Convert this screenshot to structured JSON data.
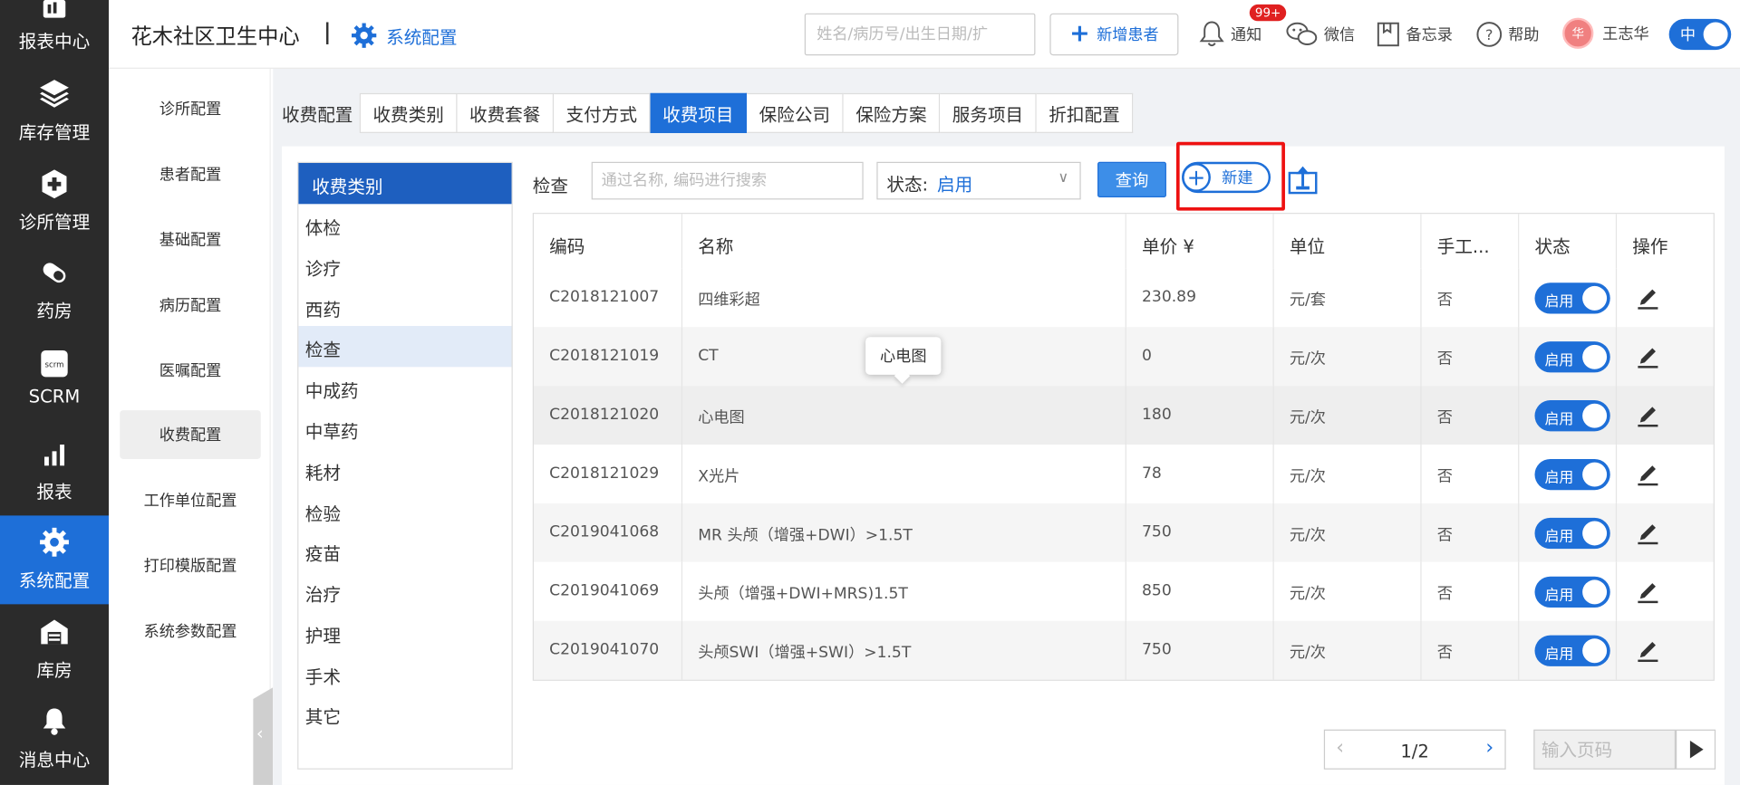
{
  "nav": {
    "items": [
      {
        "label": "报表中心",
        "icon": "report-center-icon"
      },
      {
        "label": "库存管理",
        "icon": "layers-icon"
      },
      {
        "label": "诊所管理",
        "icon": "medical-cross-icon"
      },
      {
        "label": "药房",
        "icon": "pill-icon"
      },
      {
        "label": "SCRM",
        "icon": "scrm-icon"
      },
      {
        "label": "报表",
        "icon": "bar-chart-icon"
      },
      {
        "label": "系统配置",
        "icon": "gear-icon"
      },
      {
        "label": "库房",
        "icon": "warehouse-icon"
      },
      {
        "label": "消息中心",
        "icon": "bell-icon"
      }
    ],
    "active_index": 6
  },
  "header": {
    "clinic_name": "花木社区卫生中心",
    "module": "系统配置",
    "search_placeholder": "姓名/病历号/出生日期/扩",
    "add_patient_label": "新增患者",
    "notify_label": "通知",
    "notify_badge": "99+",
    "wechat_label": "微信",
    "memo_label": "备忘录",
    "help_label": "帮助",
    "avatar_text": "华",
    "user_name": "王志华",
    "lang_label": "中"
  },
  "side_menu": {
    "items": [
      "诊所配置",
      "患者配置",
      "基础配置",
      "病历配置",
      "医嘱配置",
      "收费配置",
      "工作单位配置",
      "打印模版配置",
      "系统参数配置"
    ],
    "active_index": 5
  },
  "tabs": {
    "title": "收费配置",
    "items": [
      "收费类别",
      "收费套餐",
      "支付方式",
      "收费项目",
      "保险公司",
      "保险方案",
      "服务项目",
      "折扣配置"
    ],
    "active_index": 3
  },
  "categories": {
    "header": "收费类别",
    "items": [
      "体检",
      "诊疗",
      "西药",
      "检查",
      "中成药",
      "中草药",
      "耗材",
      "检验",
      "疫苗",
      "治疗",
      "护理",
      "手术",
      "其它"
    ],
    "selected_index": 3
  },
  "filter": {
    "label": "检查",
    "search_placeholder": "通过名称, 编码进行搜索",
    "status_label": "状态:",
    "status_value": "启用",
    "query_label": "查询",
    "new_label": "新建"
  },
  "table": {
    "columns": [
      "编码",
      "名称",
      "单价 ¥",
      "单位",
      "手工...",
      "状态",
      "操作"
    ],
    "rows": [
      {
        "code": "C2018121007",
        "name": "四维彩超",
        "price": "230.89",
        "unit": "元/套",
        "manual": "否",
        "status": "启用"
      },
      {
        "code": "C2018121019",
        "name": "CT",
        "price": "0",
        "unit": "元/次",
        "manual": "否",
        "status": "启用"
      },
      {
        "code": "C2018121020",
        "name": "心电图",
        "price": "180",
        "unit": "元/次",
        "manual": "否",
        "status": "启用"
      },
      {
        "code": "C2018121029",
        "name": "X光片",
        "price": "78",
        "unit": "元/次",
        "manual": "否",
        "status": "启用"
      },
      {
        "code": "C2019041068",
        "name": "MR 头颅（增强+DWI）>1.5T",
        "price": "750",
        "unit": "元/次",
        "manual": "否",
        "status": "启用"
      },
      {
        "code": "C2019041069",
        "name": "头颅（增强+DWI+MRS)1.5T",
        "price": "850",
        "unit": "元/次",
        "manual": "否",
        "status": "启用"
      },
      {
        "code": "C2019041070",
        "name": "头颅SWI（增强+SWI）>1.5T",
        "price": "750",
        "unit": "元/次",
        "manual": "否",
        "status": "启用"
      }
    ]
  },
  "tooltip": {
    "text": "心电图"
  },
  "pagination": {
    "page_text": "1/2",
    "goto_placeholder": "输入页码"
  },
  "colors": {
    "primary": "#1e6fd8",
    "nav_bg": "#2b2b2b",
    "highlight": "#e11111",
    "badge": "#e02020"
  }
}
